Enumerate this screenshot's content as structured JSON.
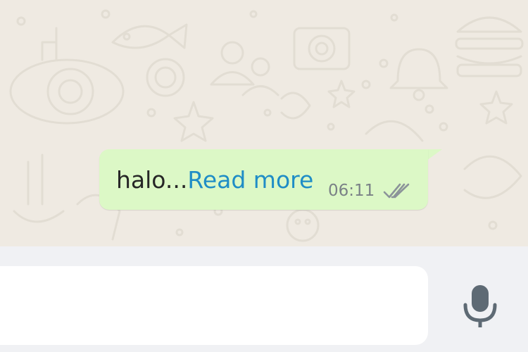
{
  "message": {
    "text": "halo...",
    "read_more_label": "Read more",
    "time": "06:11",
    "status_icon": "double-check-icon"
  },
  "composer": {
    "input_value": "",
    "mic_icon": "microphone-icon"
  },
  "colors": {
    "chat_background": "#efeae2",
    "bubble": "#dcf8c6",
    "link": "#1f8dc6",
    "composer_background": "#f0f1f4",
    "icon": "#5e6a74"
  }
}
